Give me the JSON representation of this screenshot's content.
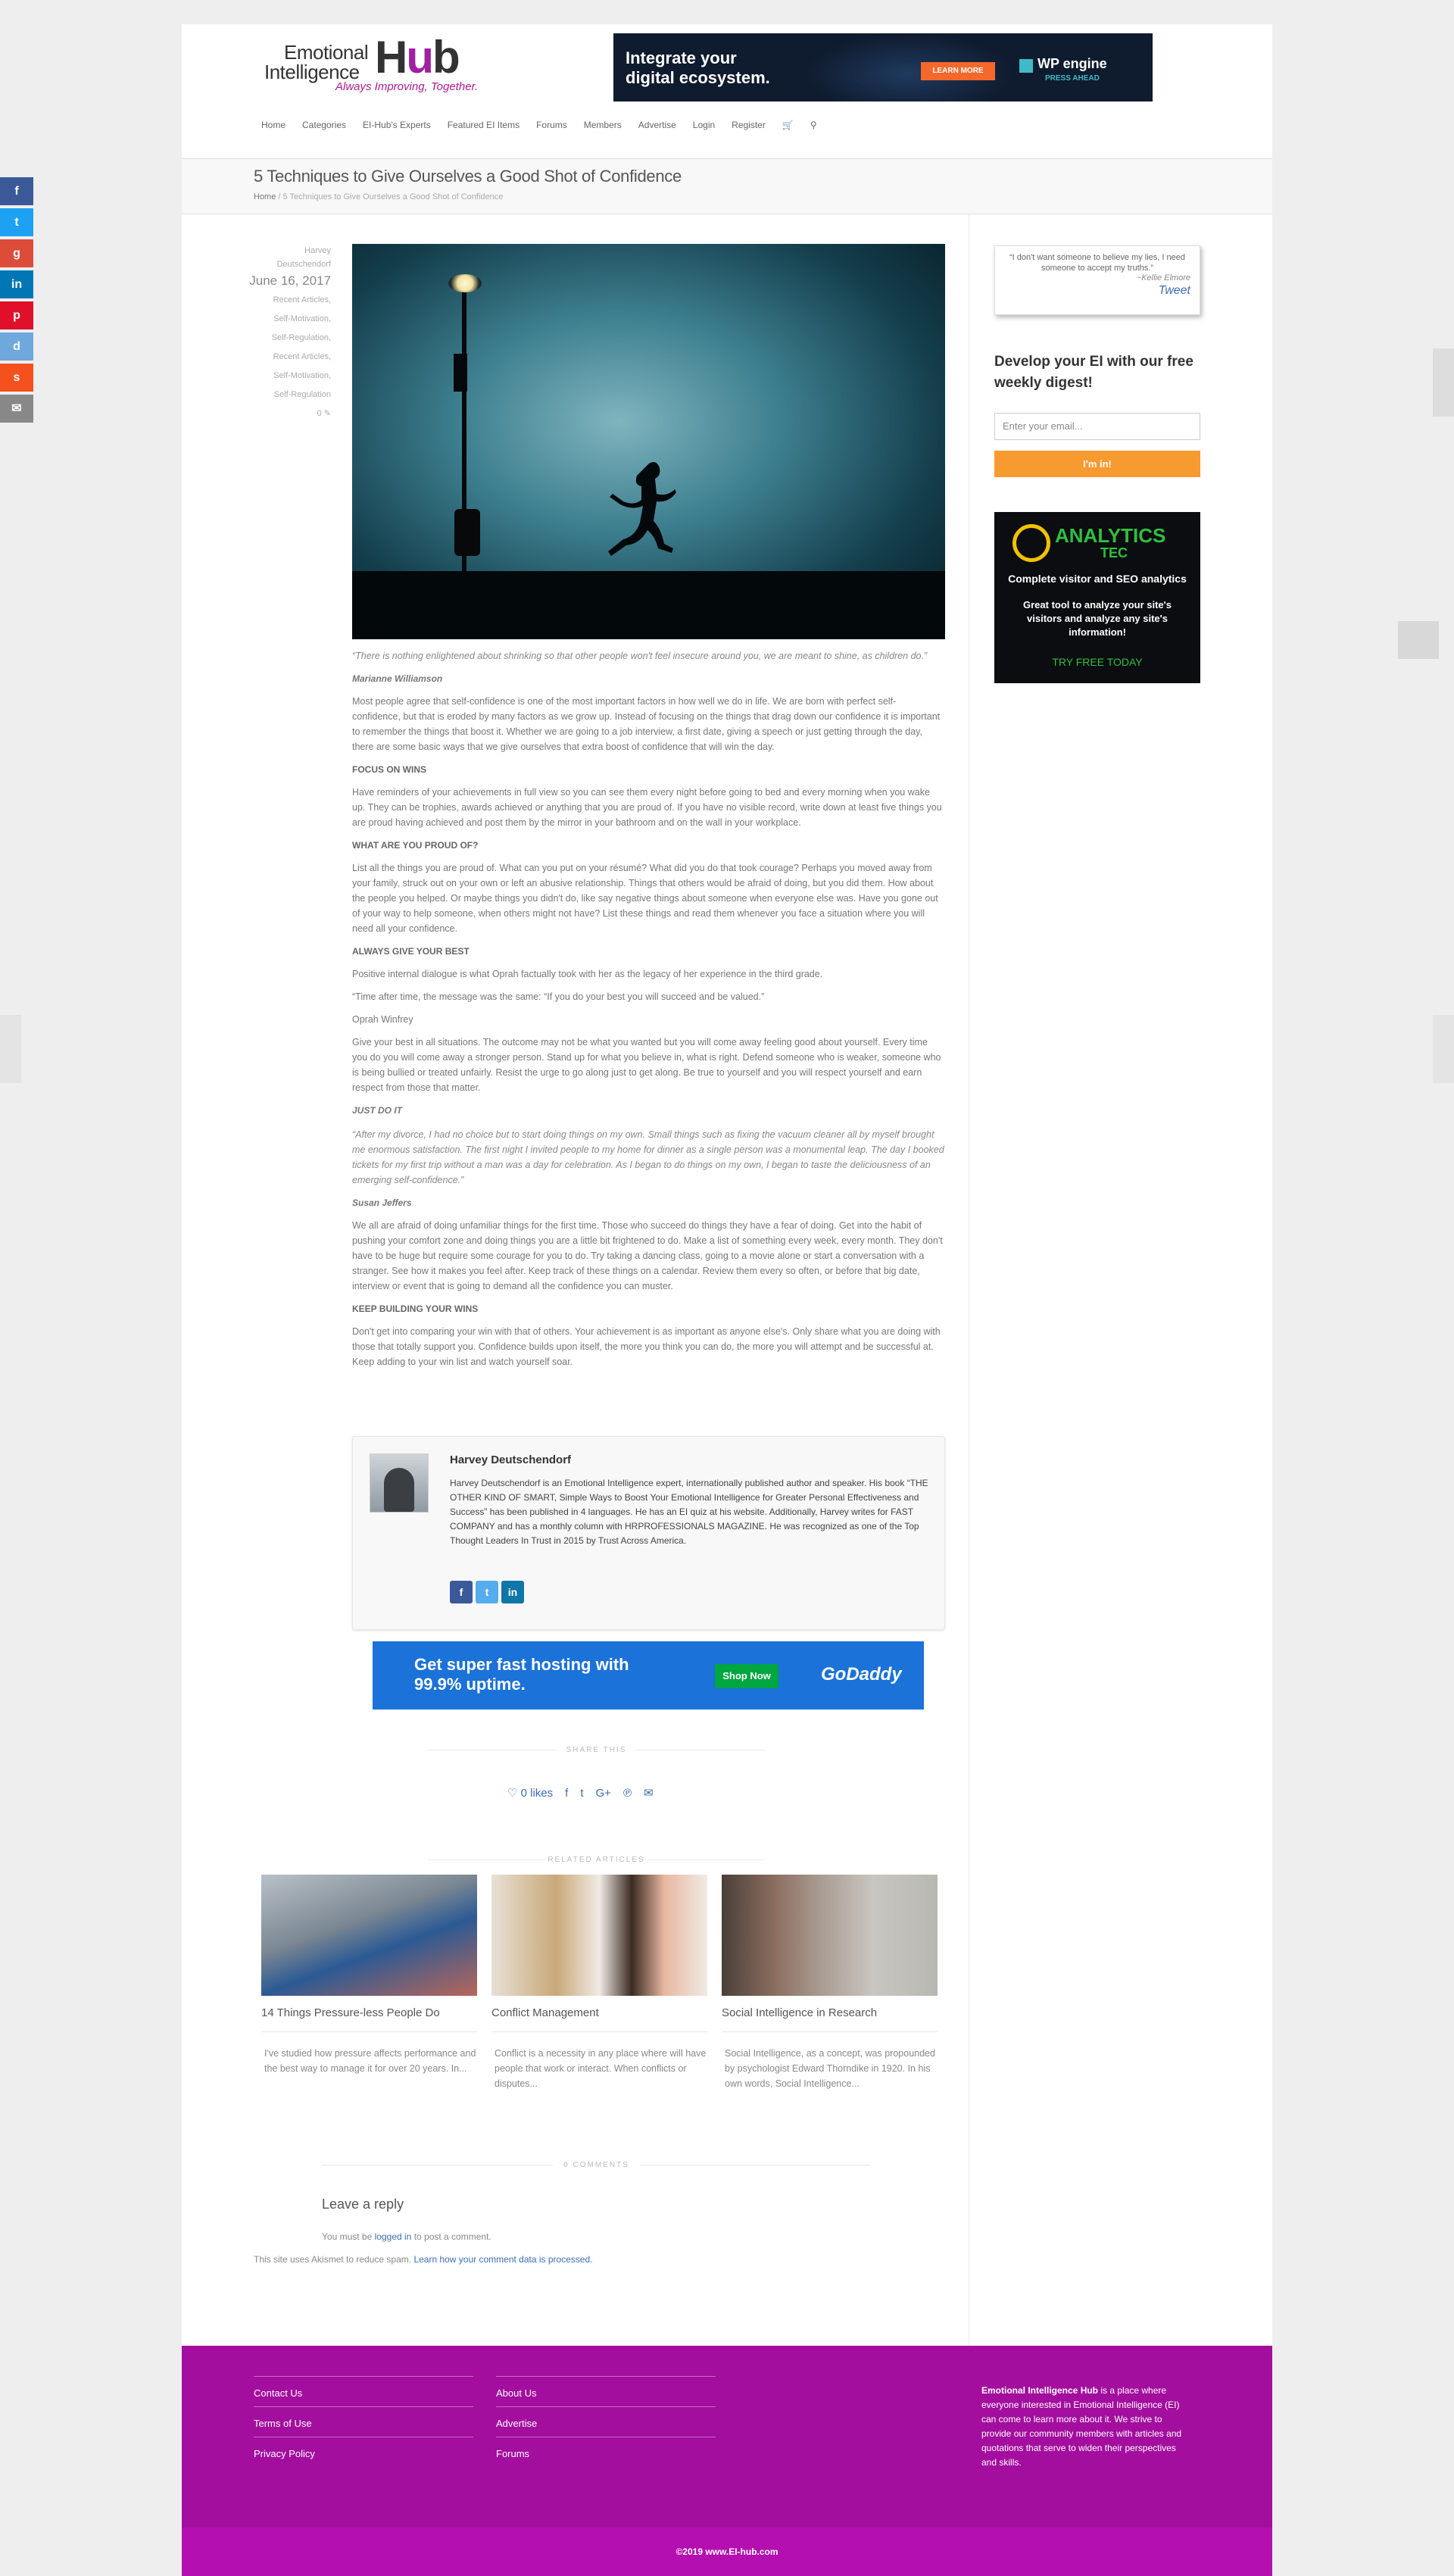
{
  "logo": {
    "line1": "Emotional",
    "line2": "Intelligence",
    "hub": "Hub",
    "tagline": "Always Improving, Together."
  },
  "top_ad": {
    "headline1": "Integrate your",
    "headline2": "digital ecosystem.",
    "button": "LEARN MORE",
    "brand": "WP engine",
    "brand_sub": "PRESS AHEAD"
  },
  "nav": [
    "Home",
    "Categories",
    "EI-Hub's Experts",
    "Featured EI Items",
    "Forums",
    "Members",
    "Advertise",
    "Login",
    "Register"
  ],
  "page_title": "5 Techniques to Give Ourselves a Good Shot of Confidence",
  "breadcrumb": {
    "home": "Home",
    "sep": "/",
    "current": "5 Techniques to Give Ourselves a Good Shot of Confidence"
  },
  "meta": {
    "author": "Harvey Deutschendorf",
    "date": "June 16, 2017",
    "cats": [
      "Recent Articles,",
      "Self-Motivation,",
      "Self-Regulation,",
      "Recent Articles,",
      "Self-Motivation,",
      "Self-Regulation"
    ],
    "count": "0"
  },
  "article": {
    "quote1": "“There is nothing enlightened about shrinking so that other people won't feel insecure around you, we are meant to shine, as children do.”",
    "quote1_author": "Marianne Williamson",
    "p1": "Most people agree that self-confidence is one of the most important factors in how well we do in life. We are born with perfect self- confidence, but that is eroded by many factors as we grow up. Instead of focusing on the things that drag down our confidence it is important to remember the things that boost it. Whether we are going to a job interview, a first date, giving a speech or just getting through the day, there are some basic ways that we give ourselves that extra boost of confidence that will win the day.",
    "h1": "FOCUS ON WINS",
    "p2": "Have reminders of your achievements in full view so you can see them every night before going to bed and every morning when you wake up. They can be trophies, awards achieved or anything that you are proud of. If you have no visible record, write down at least five things you are proud having achieved and post them by the mirror in your bathroom and on the wall in your workplace.",
    "h2": "WHAT ARE YOU PROUD OF?",
    "p3": "List all the things you are proud of. What can you put on your résumé? What did you do that took courage? Perhaps you moved away from your family, struck out on your own or left an abusive relationship. Things that others would be afraid of doing, but you did them. How about the people you helped. Or maybe things you didn't do, like say negative things about someone when everyone else was. Have you gone out of your way to help someone, when others might not have? List these things and read them whenever you face a situation where you will need all your confidence.",
    "h3": "ALWAYS GIVE YOUR BEST",
    "p4": "Positive internal dialogue is what Oprah factually took with her as the legacy of her experience in the third grade.",
    "p5": "“Time after time, the message was the same: “If you do your best you will succeed and be valued.”",
    "p6": "Oprah Winfrey",
    "p7": "Give your best in all situations. The outcome may not be what you wanted but you will come away feeling good about yourself. Every time you do you will come away a stronger person. Stand up for what you believe in, what is right. Defend someone who is weaker, someone who is being bullied or treated unfairly. Resist the urge to go along just to get along. Be true to yourself and you will respect yourself and earn respect from those that matter.",
    "h4": "JUST DO IT",
    "quote2": "“After my divorce, I had no choice but to start doing things on my own. Small things such as fixing the vacuum cleaner all by myself brought me enormous satisfaction. The first night I invited people to my home for dinner as a single person was a monumental leap. The day I booked tickets for my first trip without a man was a day for celebration. As I began to do things on my own, I began to taste the deliciousness of an emerging self-confidence.”",
    "quote2_author": "Susan Jeffers",
    "p8": "We all are afraid of doing unfamiliar things for the first time. Those who succeed do things they have a fear of doing. Get into the habit of pushing your comfort zone and doing things you are a little bit frightened to do. Make a list of something every week, every month. They don't have to be huge but require some courage for you to do. Try taking a dancing class, going to a movie alone or start a conversation with a stranger. See how it makes you feel after. Keep track of these things on a calendar. Review them every so often, or before that big date, interview or event that is going to demand all the confidence you can muster.",
    "h5": "KEEP BUILDING YOUR WINS",
    "p9": "Don't get into comparing your win with that of others. Your achievement is as important as anyone else's. Only share what you are doing with those that totally support you. Confidence builds upon itself, the more you think you can do, the more you will attempt and be successful at. Keep adding to your win list and watch yourself soar."
  },
  "author_box": {
    "name": "Harvey Deutschendorf",
    "bio": "Harvey Deutschendorf is an Emotional Intelligence expert, internationally published author and speaker. His book “THE OTHER KIND OF SMART, Simple Ways to Boost Your Emotional Intelligence for Greater Personal Effectiveness and Success” has been published in 4 languages. He has an EI quiz at his website. Additionally, Harvey writes for FAST COMPANY and has a monthly column with HRPROFESSIONALS MAGAZINE. He was recognized as one of the Top Thought Leaders In Trust in 2015 by Trust Across America.",
    "socials": [
      "f",
      "t",
      "in"
    ]
  },
  "gd_ad": {
    "headline1": "Get super fast hosting with",
    "headline2": "99.9% uptime.",
    "button": "Shop Now",
    "brand": "GoDaddy"
  },
  "share": {
    "label": "SHARE THIS",
    "likes": "0 likes"
  },
  "related": {
    "label": "RELATED ARTICLES",
    "items": [
      {
        "title": "14 Things Pressure-less People Do",
        "excerpt": "I've studied how pressure affects performance and the best way to manage it for over 20 years. In..."
      },
      {
        "title": "Conflict Management",
        "excerpt": "Conflict is a necessity in any place where will have people that work or interact. When conflicts or disputes..."
      },
      {
        "title": "Social Intelligence in Research",
        "excerpt": "Social Intelligence, as a concept, was propounded by psychologist Edward Thorndike in 1920. In his own words, Social Intelligence..."
      }
    ]
  },
  "comments": {
    "label": "0 COMMENTS",
    "reply": "Leave a reply",
    "must_pre": "You must be",
    "must_link": "logged in",
    "must_post": "to post a comment.",
    "akismet_pre": "This site uses Akismet to reduce spam.",
    "akismet_link": "Learn how your comment data is processed."
  },
  "sidebar": {
    "quote": "“I don't want someone to believe my lies, I need someone to accept my truths.”",
    "quote_author": "~Kellie Elmore",
    "tweet": "Tweet",
    "digest": "Develop your EI with our free weekly digest!",
    "email_placeholder": "Enter your email...",
    "submit": "I'm in!",
    "ad": {
      "brand": "ANALYTICS",
      "brand2": "TEC",
      "s1": "Complete visitor and SEO analytics",
      "s2": "Great tool to analyze your site's visitors and analyze any site's information!",
      "cta": "TRY FREE TODAY"
    }
  },
  "footer": {
    "col1": [
      "Contact Us",
      "Terms of Use",
      "Privacy Policy"
    ],
    "col2": [
      "About Us",
      "Advertise",
      "Forums"
    ],
    "about_bold": "Emotional Intelligence Hub",
    "about": " is a place where everyone interested in Emotional Intelligence (EI) can come to learn more about it. We strive to provide our community members with articles and quotations that serve to widen their perspectives and skills.",
    "copyright": "©2019 www.EI-hub.com"
  },
  "colors": {
    "accent": "#a30e9e",
    "link": "#3d6db0",
    "button": "#f79a2f"
  }
}
